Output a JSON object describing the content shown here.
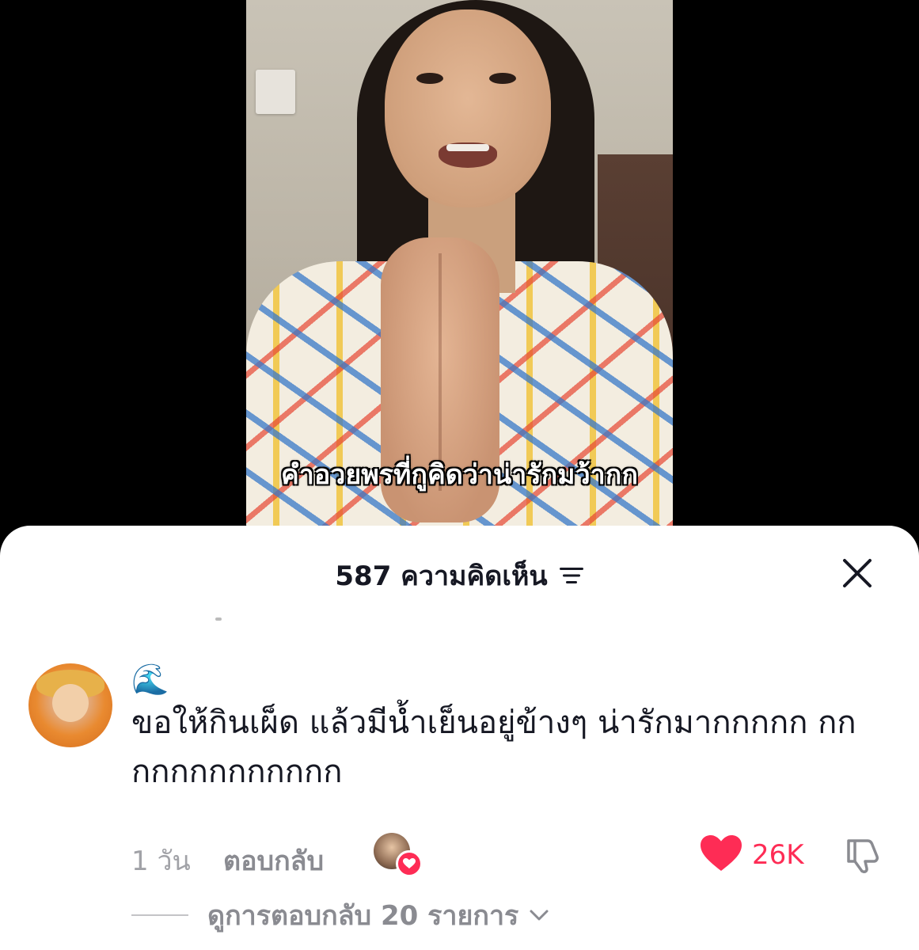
{
  "video": {
    "subtitle": "คำอวยพรที่กูคิดว่าน่ารักมว้ากก"
  },
  "comments_panel": {
    "count_label": "587 ความคิดเห็น",
    "sort_icon": "sort-icon",
    "close_icon": "close-icon"
  },
  "comment": {
    "username": "🌊",
    "text": "ขอให้กินเผ็ด แล้วมีน้ำเย็นอยู่ข้างๆ น่ารักมากกกกก กกกกกกกกกกกกก",
    "timestamp": "1 วัน",
    "reply_label": "ตอบกลับ",
    "like_count": "26K",
    "view_replies_label": "ดูการตอบกลับ 20 รายการ"
  },
  "colors": {
    "accent": "#fe2c55",
    "text_primary": "#161823",
    "text_secondary": "#8a8b91"
  }
}
